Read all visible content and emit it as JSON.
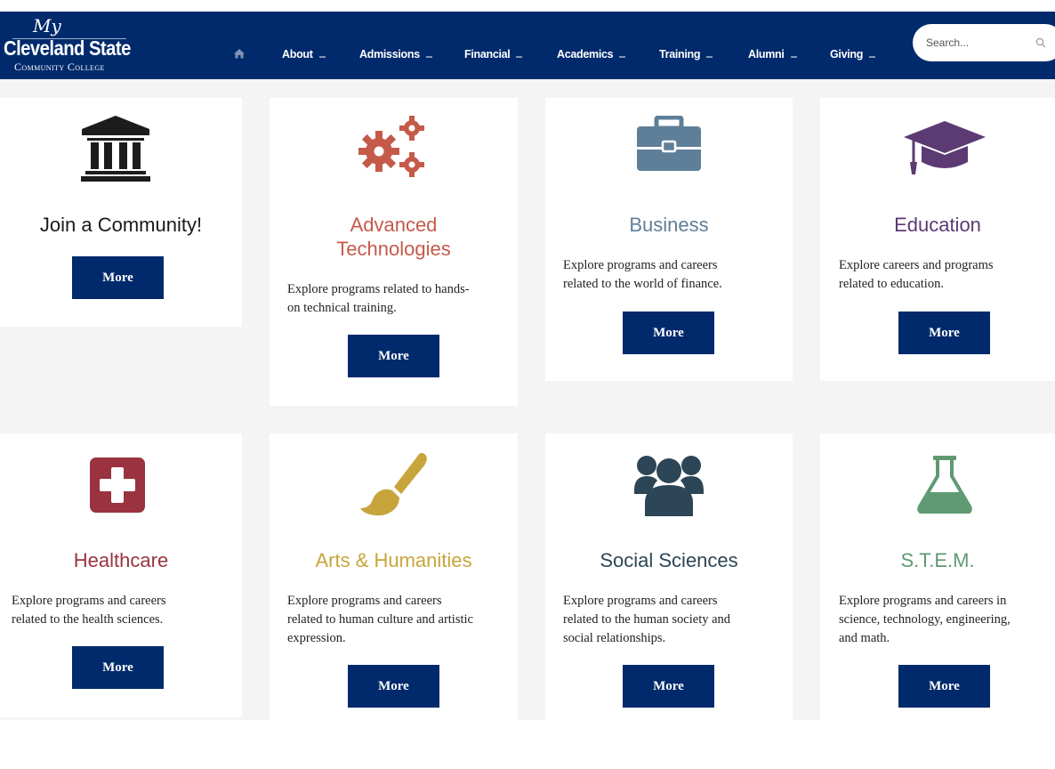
{
  "header": {
    "logo": {
      "my": "My",
      "name": "Cleveland State",
      "sub": "Community College"
    },
    "nav": [
      {
        "label": "About"
      },
      {
        "label": "Admissions"
      },
      {
        "label": "Financial"
      },
      {
        "label": "Academics"
      },
      {
        "label": "Training"
      },
      {
        "label": "Alumni"
      },
      {
        "label": "Giving"
      }
    ],
    "search": {
      "placeholder": "Search..."
    }
  },
  "colors": {
    "brand": "#002a6c",
    "advanced": "#c55a4a",
    "business": "#5f7f98",
    "education": "#5c3a73",
    "healthcare": "#9a333f",
    "arts": "#c8a53c",
    "social": "#2d4657",
    "stem": "#5f9a72"
  },
  "cards": [
    {
      "title": "Join a Community!",
      "icon": "bank-icon",
      "more": "More"
    },
    {
      "title": "Advanced Technologies",
      "title_l1": "Advanced",
      "title_l2": "Technologies",
      "icon": "gears-icon",
      "desc_l1": "Explore programs related to hands-",
      "desc_l2": "on technical training.",
      "more": "More"
    },
    {
      "title": "Business",
      "icon": "briefcase-icon",
      "desc_l1": "Explore programs and careers",
      "desc_l2": "related to the world of finance.",
      "more": "More"
    },
    {
      "title": "Education",
      "icon": "graduation-cap-icon",
      "desc_l1": "Explore careers and programs",
      "desc_l2": "related to education.",
      "more": "More"
    },
    {
      "title": "Healthcare",
      "icon": "medical-cross-icon",
      "desc_l1": "Explore programs and careers",
      "desc_l2": "related to the health sciences.",
      "more": "More"
    },
    {
      "title": "Arts & Humanities",
      "icon": "paintbrush-icon",
      "desc_l1": "Explore programs and careers",
      "desc_l2": "related to human culture and artistic",
      "desc_l3": "expression.",
      "more": "More"
    },
    {
      "title": "Social Sciences",
      "icon": "group-icon",
      "desc_l1": "Explore programs and careers",
      "desc_l2": "related to the human society and",
      "desc_l3": "social relationships.",
      "more": "More"
    },
    {
      "title": "S.T.E.M.",
      "icon": "flask-icon",
      "desc_l1": "Explore programs and careers in",
      "desc_l2": "science, technology, engineering,",
      "desc_l3": "and math.",
      "more": "More"
    }
  ]
}
